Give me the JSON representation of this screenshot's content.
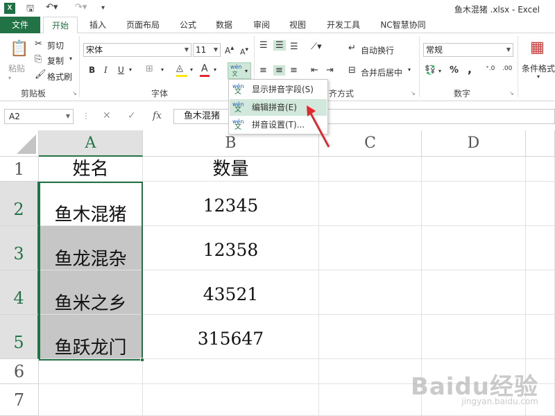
{
  "window": {
    "title": "鱼木混猪 .xlsx - Excel",
    "app_icon": "X"
  },
  "tabs": [
    {
      "label": "文件"
    },
    {
      "label": "开始"
    },
    {
      "label": "插入"
    },
    {
      "label": "页面布局"
    },
    {
      "label": "公式"
    },
    {
      "label": "数据"
    },
    {
      "label": "审阅"
    },
    {
      "label": "视图"
    },
    {
      "label": "开发工具"
    },
    {
      "label": "NC智慧协同"
    }
  ],
  "ribbon": {
    "clipboard": {
      "paste": "粘贴",
      "cut": "剪切",
      "copy": "复制",
      "format_painter": "格式刷",
      "label": "剪贴板"
    },
    "font": {
      "name": "宋体",
      "size": "11",
      "bold": "B",
      "italic": "I",
      "underline": "U",
      "label": "字体",
      "phonetic": "wén 文"
    },
    "alignment": {
      "wrap": "自动换行",
      "merge": "合并后居中",
      "label": "对齐方式",
      "label_visible": "齐方式"
    },
    "number": {
      "format": "常规",
      "percent": "%",
      "comma": ",",
      "label": "数字"
    },
    "styles": {
      "conditional": "条件格式"
    }
  },
  "phonetic_menu": {
    "items": [
      {
        "label": "显示拼音字段(S)",
        "icon": "phonetic-icon"
      },
      {
        "label": "编辑拼音(E)",
        "icon": "phonetic-edit-icon"
      },
      {
        "label": "拼音设置(T)...",
        "icon": "phonetic-settings-icon"
      }
    ]
  },
  "formula_bar": {
    "name_box": "A2",
    "value": "鱼木混猪"
  },
  "sheet": {
    "columns": [
      "A",
      "B",
      "C",
      "D"
    ],
    "rows": [
      "1",
      "2",
      "3",
      "4",
      "5",
      "6",
      "7"
    ],
    "header": [
      "姓名",
      "数量"
    ],
    "data": [
      {
        "name": "鱼木混猪",
        "qty": "12345"
      },
      {
        "name": "鱼龙混杂",
        "qty": "12358"
      },
      {
        "name": "鱼米之乡",
        "qty": "43521"
      },
      {
        "name": "鱼跃龙门",
        "qty": "315647"
      }
    ]
  },
  "watermark": {
    "main": "Baidu经验",
    "sub": "jingyan.baidu.com"
  },
  "colors": {
    "accent": "#217346",
    "arrow": "#e0282e",
    "selection_shade": "#c6c6c6"
  }
}
